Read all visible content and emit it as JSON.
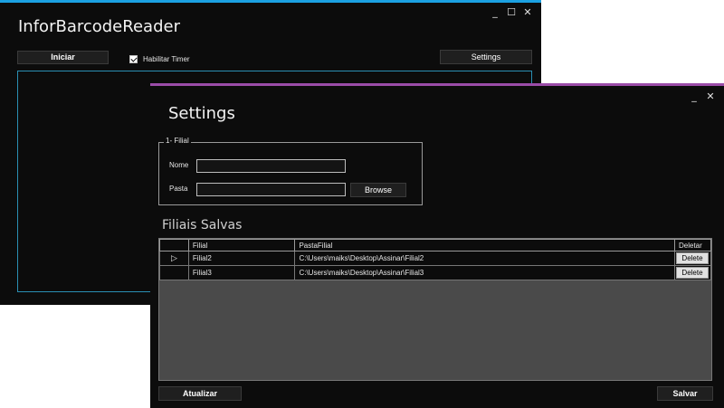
{
  "main_window": {
    "title": "InforBarcodeReader",
    "buttons": {
      "minimize": "_",
      "maximize": "☐",
      "close": "✕"
    },
    "iniciar_label": "Iniciar",
    "timer_label": "Habilitar Timer",
    "timer_checked": true,
    "settings_label": "Settings"
  },
  "settings_window": {
    "title": "Settings",
    "buttons": {
      "minimize": "_",
      "close": "✕"
    },
    "group_title": "1- Filial",
    "nome_label": "Nome",
    "nome_value": "",
    "pasta_label": "Pasta",
    "pasta_value": "",
    "browse_label": "Browse",
    "section_title": "Filiais Salvas",
    "grid": {
      "columns": [
        "",
        "Filial",
        "PastaFilial",
        "Deletar"
      ],
      "rows": [
        {
          "selector": "▷",
          "filial": "Filial2",
          "pasta": "C:\\Users\\maiks\\Desktop\\Assinar\\Filial2",
          "delete": "Delete"
        },
        {
          "selector": "",
          "filial": "Filial3",
          "pasta": "C:\\Users\\maiks\\Desktop\\Assinar\\Filial3",
          "delete": "Delete"
        }
      ]
    },
    "atualizar_label": "Atualizar",
    "salvar_label": "Salvar"
  },
  "colors": {
    "main_accent": "#1ba1e2",
    "settings_accent": "#9b4ca8",
    "background": "#0c0c0c"
  }
}
